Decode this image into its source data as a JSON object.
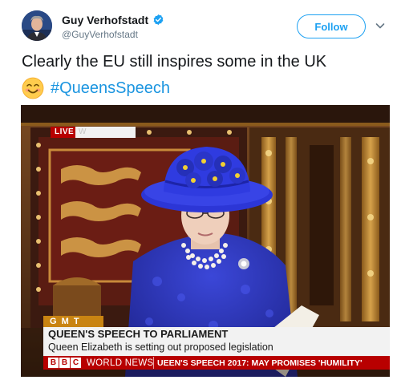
{
  "author": {
    "name": "Guy Verhofstadt",
    "handle": "@GuyVerhofstadt",
    "verified": true,
    "verified_color": "#1da1f2"
  },
  "follow_button": {
    "label": "Follow",
    "color": "#1da1f2"
  },
  "tweet": {
    "text": "Clearly the EU still inspires some in the UK",
    "emoji": "smiling-face-emoji",
    "hashtag": "#QueensSpeech",
    "hashtag_color": "#1b95e0"
  },
  "photo": {
    "description_icon": "tv-broadcast-photo",
    "live_label": "LIVE",
    "live_extra": "W",
    "timezone_label": "G M T",
    "headline": "QUEEN'S SPEECH TO PARLIAMENT",
    "subheadline": "Queen Elizabeth is setting out proposed legislation",
    "channel_logo": [
      "B",
      "B",
      "C"
    ],
    "channel_name": "WORLD NEWS",
    "ticker_text": "UEEN'S SPEECH 2017: MAY PROMISES 'HUMILITY'",
    "ticker_color": "#b80000",
    "gmt_color": "#c98412"
  }
}
